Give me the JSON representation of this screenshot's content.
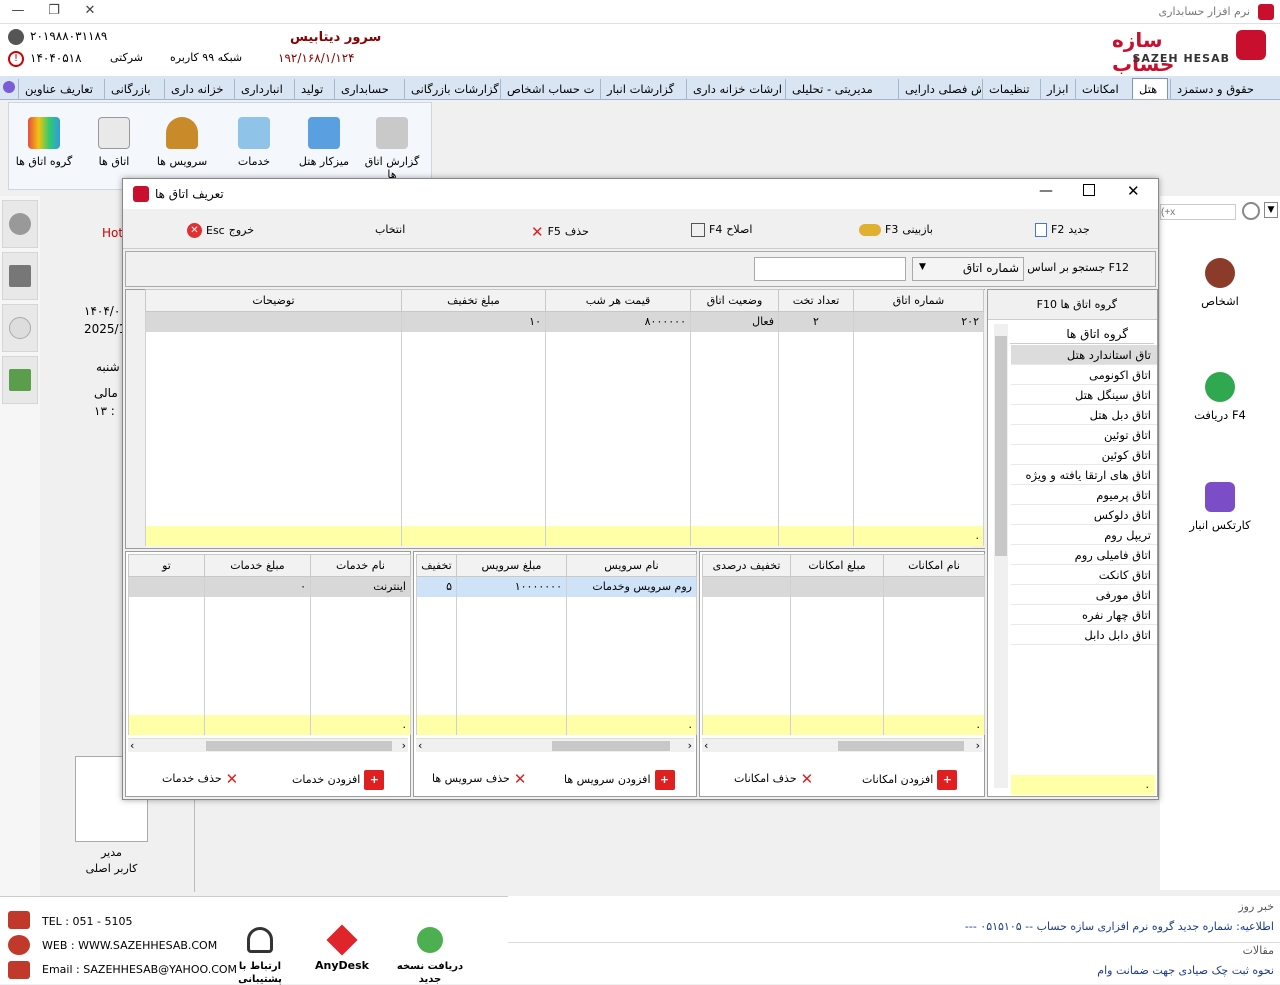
{
  "window": {
    "title": "نرم افزار حسابداری"
  },
  "header": {
    "logo_fa": "سازه حساب",
    "logo_en": "SAZEH HESAB",
    "server_title": "سرور دیتابیس",
    "server_ip": "۱۹۲/۱۶۸/۱/۱۲۴",
    "network": "شبکه ۹۹ کاربره",
    "company": "شرکتی",
    "serial": "۲۰۱۹۸۸۰۳۱۱۸۹",
    "code": "۱۴۰۴۰۵۱۸"
  },
  "tabs": [
    "حقوق و دستمزد",
    "هتل",
    "امکانات",
    "ابزار",
    "تنظیمات",
    "ش فصلی دارایی",
    "مدیریتی - تحلیلی",
    "ارشات خزانه داری",
    "گزارشات انبار",
    "ت حساب اشخاص",
    "گزارشات بازرگانی",
    "حسابداری",
    "تولید",
    "انبارداری",
    "خزانه داری",
    "بازرگانی",
    "تعاریف عناوین"
  ],
  "ribbon": [
    "گزارش اتاق ها",
    "میزکار هتل",
    "خدمات",
    "سرویس ها",
    "اتاق ها",
    "گروه اتاق ها"
  ],
  "left_fragments": {
    "hot": "Hot",
    "date1": "۱۴۰۴/۰",
    "date2": "2025/1",
    "day": "شنبه",
    "fiscal": "مالی",
    "time": "۱۳ :"
  },
  "user_box": {
    "role": "مدیر",
    "name": "کاربر اصلی"
  },
  "right_panel": {
    "search_placeholder": "(+x",
    "persons": "اشخاص",
    "receive": "دریافت",
    "receive_key": "F4",
    "cardex": "کارتکس انبار"
  },
  "dialog": {
    "title": "تعریف اتاق ها",
    "toolbar": {
      "new": "جدید",
      "new_key": "F2",
      "view": "بازبینی",
      "view_key": "F3",
      "edit": "اصلاح",
      "edit_key": "F4",
      "delete": "حذف",
      "delete_key": "F5",
      "select": "انتخاب",
      "exit": "خروج",
      "exit_key": "Esc"
    },
    "search": {
      "label": "F12 جستجو بر اساس :",
      "field": "شماره اتاق",
      "value": ""
    },
    "groups": {
      "header": "گروه اتاق ها",
      "header_key": "F10",
      "title": "گروه اتاق ها",
      "items": [
        "تاق استاندارد هتل",
        "اتاق اکونومی",
        "اتاق سینگل هتل",
        "اتاق دبل هتل",
        "اتاق توئین",
        "اتاق کوئین",
        "اتاق های ارتقا یافته و ویژه",
        "اتاق پرمیوم",
        "اتاق دلوکس",
        "تریپل روم",
        "اتاق فامیلی روم",
        "اتاق کانکت",
        "اتاق مورفی",
        "اتاق چهار نفره",
        "اتاق دابل دابل"
      ],
      "footer": "."
    },
    "rooms": {
      "headers": [
        "شماره اتاق",
        "تعداد تخت",
        "وضعیت اتاق",
        "قیمت هر شب",
        "مبلغ تخفیف",
        "توضیحات"
      ],
      "rows": [
        [
          "۲۰۲",
          "۲",
          "فعال",
          "۸۰۰۰۰۰۰",
          "۱۰",
          ""
        ]
      ],
      "footer": "."
    },
    "facilities": {
      "headers": [
        "نام امکانات",
        "مبلغ امکانات",
        "تخفیف درصدی"
      ],
      "footer": ".",
      "add": "افزودن امکانات",
      "remove": "حذف امکانات"
    },
    "services": {
      "headers": [
        "نام سرویس",
        "مبلغ سرویس",
        "تخفیف"
      ],
      "rows": [
        [
          "روم سرویس وخدمات",
          "۱۰۰۰۰۰۰۰",
          "۵"
        ]
      ],
      "footer": ".",
      "add": "افزودن سرویس ها",
      "remove": "حذف سرویس ها"
    },
    "extras": {
      "headers": [
        "نام خدمات",
        "مبلغ خدمات",
        "تو"
      ],
      "rows": [
        [
          "اینترنت",
          "۰",
          ""
        ]
      ],
      "footer": ".",
      "add": "افزودن خدمات",
      "remove": "حذف خدمات"
    }
  },
  "footer": {
    "tel": "TEL : 051 - 5105",
    "web": "WEB : WWW.SAZEHHESAB.COM",
    "email": "Email : SAZEHHESAB@YAHOO.COM",
    "support": "ارتباط با پشتیبانی",
    "anydesk": "AnyDesk",
    "update": "دریافت نسخه جدید",
    "news_title": "خبر روز",
    "news_text": "اطلاعیه: شماره جدید گروه نرم افزاری سازه حساب -- ۰۵۱۵۱۰۵ ---",
    "articles_title": "مقالات",
    "article": "نحوه ثبت چک صیادی جهت ضمانت وام"
  }
}
